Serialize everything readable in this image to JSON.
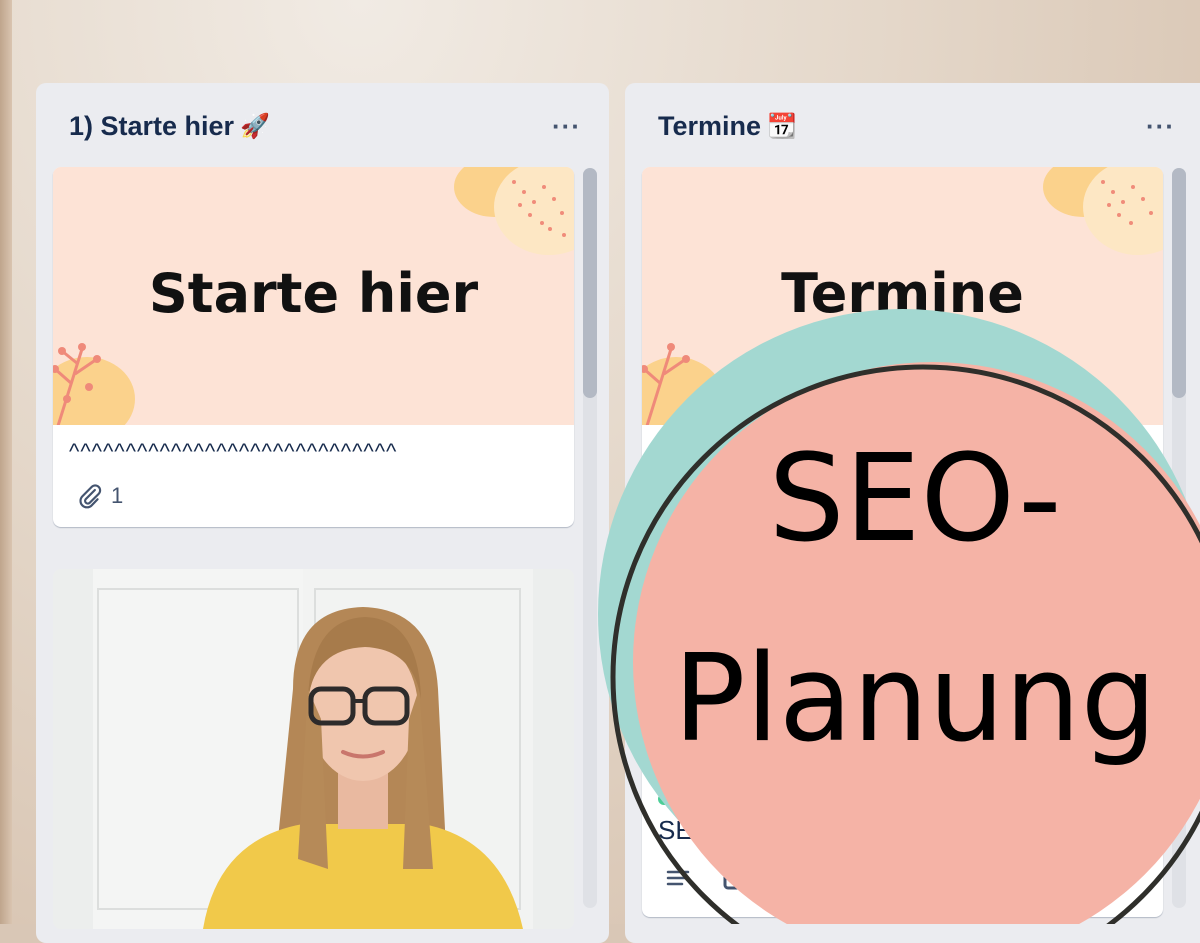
{
  "lists": [
    {
      "title": "1) Starte hier",
      "emoji": "🚀",
      "menu": "···",
      "card": {
        "cover_title": "Starte hier",
        "text": "^^^^^^^^^^^^^^^^^^^^^^^^^^^^^",
        "attachment_count": "1"
      }
    },
    {
      "title": "Termine",
      "emoji": "📆",
      "menu": "···",
      "card": {
        "cover_title": "Termine",
        "partial_text": "SE"
      }
    }
  ],
  "overlay": {
    "line1": "SEO-",
    "line2": "Planung"
  },
  "colors": {
    "list_bg": "#ebecf0",
    "cover_bg": "#fde3d6",
    "overlay_teal": "#a3d8d1",
    "overlay_salmon": "#f5b3a6"
  }
}
